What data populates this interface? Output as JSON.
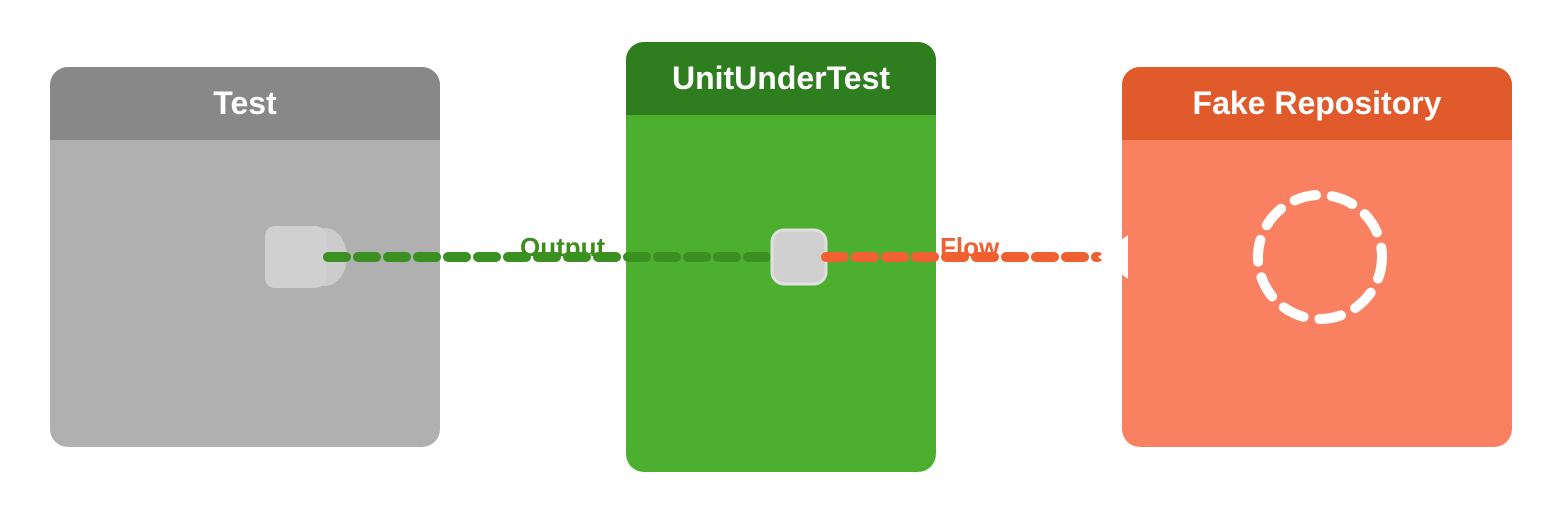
{
  "panels": {
    "test": {
      "label": "Test",
      "header_bg": "#888888",
      "body_bg": "#b0b0b0"
    },
    "unit": {
      "label": "UnitUnderTest",
      "header_bg": "#2e7d1e",
      "body_bg": "#4caf30"
    },
    "fake": {
      "label": "Fake Repository",
      "header_bg": "#e05a2b",
      "body_bg": "#f98060"
    }
  },
  "labels": {
    "output": "Output",
    "flow": "Flow"
  },
  "colors": {
    "green_line": "#3a9020",
    "orange_line": "#f06030",
    "white": "#ffffff"
  }
}
